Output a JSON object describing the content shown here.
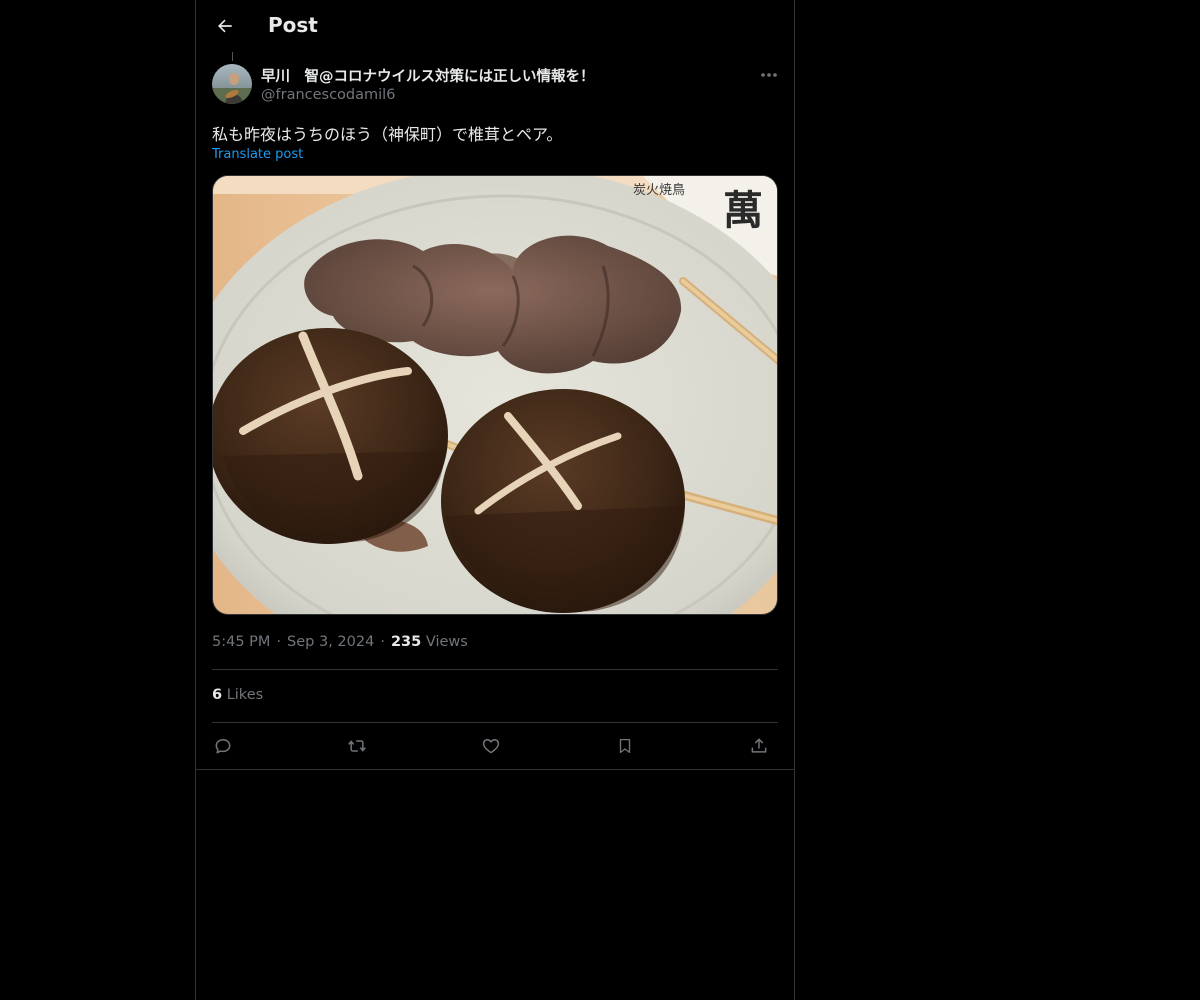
{
  "header": {
    "title": "Post",
    "back_icon": "arrow-left-icon"
  },
  "author": {
    "display_name": "早川　智@コロナウイルス対策には正しい情報を！",
    "handle": "@francescodamil6",
    "more_icon": "more-horizontal-icon"
  },
  "post": {
    "text": "私も昨夜はうちのほう（神保町）で椎茸とペア。",
    "translate_label": "Translate post",
    "time": "5:45 PM",
    "date": "Sep 3, 2024",
    "views_count": "235",
    "views_label": "Views",
    "likes_count": "6",
    "likes_label": "Likes",
    "separator": "·"
  },
  "media": {
    "plate_text": "萬",
    "plate_sub_text": "炭火焼鳥"
  },
  "actions": [
    {
      "name": "reply",
      "icon": "reply-icon"
    },
    {
      "name": "repost",
      "icon": "repost-icon"
    },
    {
      "name": "like",
      "icon": "heart-icon"
    },
    {
      "name": "bookmark",
      "icon": "bookmark-icon"
    },
    {
      "name": "share",
      "icon": "share-icon"
    }
  ],
  "colors": {
    "background": "#000000",
    "text_primary": "#e7e9ea",
    "text_secondary": "#71767b",
    "link": "#1d9bf0",
    "border": "#2f3336"
  }
}
